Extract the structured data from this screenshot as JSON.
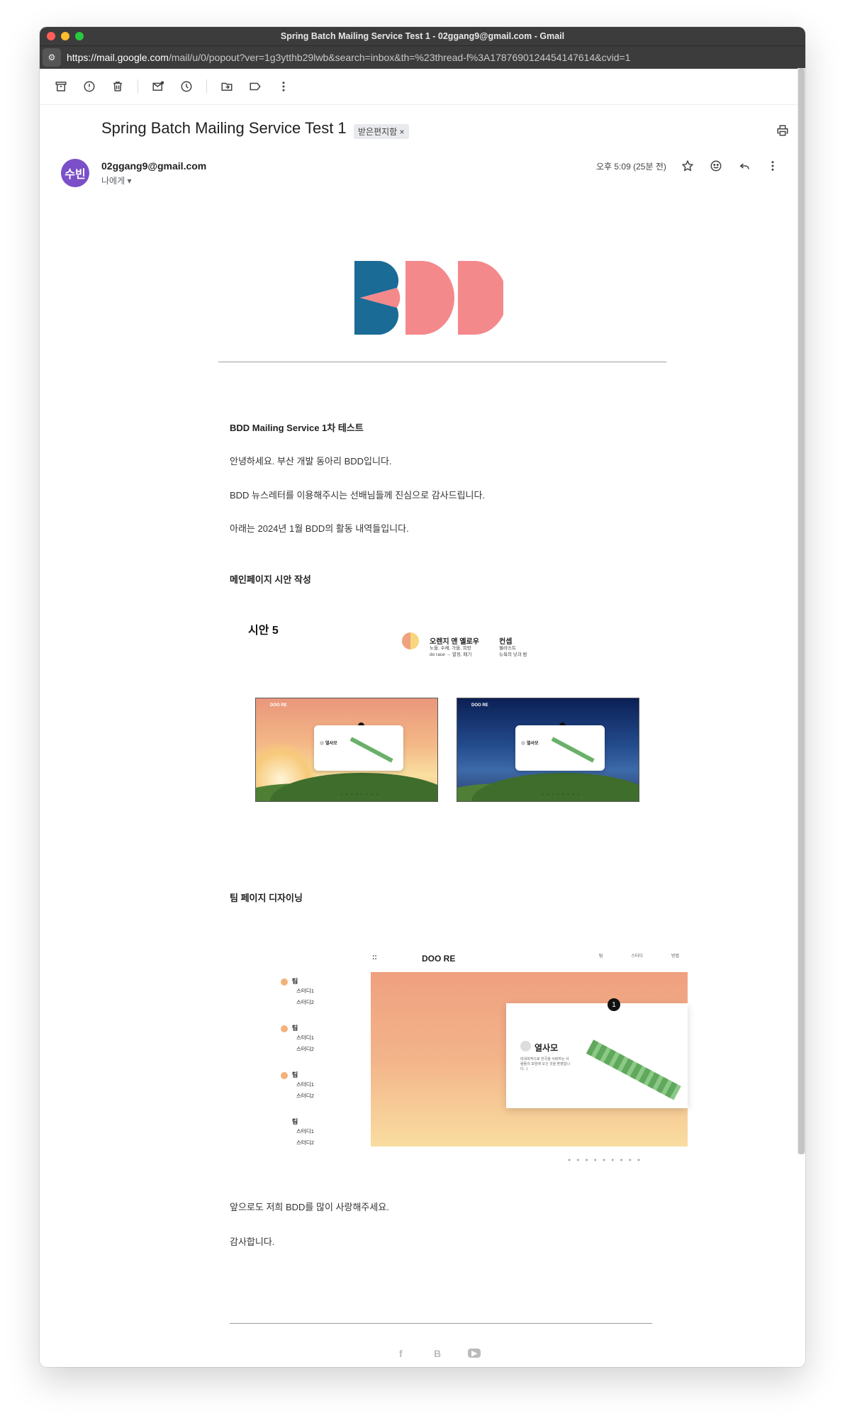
{
  "window": {
    "title": "Spring Batch Mailing Service Test 1 - 02ggang9@gmail.com - Gmail"
  },
  "url": {
    "host": "https://mail.google.com",
    "path": "/mail/u/0/popout?ver=1g3ytthb29lwb&search=inbox&th=%23thread-f%3A1787690124454147614&cvid=1"
  },
  "toolbar": {
    "icons": [
      "archive-icon",
      "report-spam-icon",
      "delete-icon",
      "mark-unread-icon",
      "snooze-icon",
      "move-to-icon",
      "label-icon",
      "more-icon"
    ]
  },
  "email": {
    "subject": "Spring Batch Mailing Service Test 1",
    "label_chip": "받은편지함 ×",
    "avatar_text": "수빈",
    "sender": "02ggang9@gmail.com",
    "to": "나에게 ▾",
    "time": "오후 5:09 (25분 전)"
  },
  "content": {
    "heading": "BDD Mailing Service 1차 테스트",
    "p1": "안녕하세요. 부산 개발 동아리 BDD입니다.",
    "p2": "BDD 뉴스레터를 이용해주시는 선배님들께 진심으로 감사드립니다.",
    "p3": "아래는 2024년 1월 BDD의 활동 내역들입니다.",
    "section1": "메인페이지 시안 작성",
    "sian": "시안 5",
    "legend1_title": "오렌지 앤 옐로우",
    "legend1_sub1": "노을, 수채, 가을, 희망",
    "legend1_sub2": "do race → 열정, 패기",
    "legend2_title": "컨셉",
    "legend2_sub1": "웰라스트",
    "legend2_sub2": "뉴욕의 낮과 밤",
    "shot_brand": "DOO RE",
    "shot_card_title": "열사모",
    "section2": "팀 페이지 디자이닝",
    "team_items": [
      {
        "title": "팀",
        "subs": [
          "스터디1",
          "스터디2"
        ]
      },
      {
        "title": "팀",
        "subs": [
          "스터디1",
          "스터디2"
        ]
      },
      {
        "title": "팀",
        "subs": [
          "스터디1",
          "스터디2"
        ]
      },
      {
        "title": "팀",
        "subs": [
          "스터디1",
          "스터디2"
        ]
      }
    ],
    "team_brand": "DOO RE",
    "team_nav": [
      "팀",
      "스터디",
      "방법"
    ],
    "team_card_title": "열사모",
    "team_card_text": "대내외적으로 한국을 사랑하는 사람들의 모임에 오신 것을 환영합니다. :)",
    "team_badge": "1",
    "closing1": "앞으로도 저희 BDD를 많이 사랑해주세요.",
    "closing2": "감사합니다."
  },
  "logo_colors": {
    "blue": "#1a6b95",
    "pink": "#f4898b"
  },
  "social": {
    "facebook": "f",
    "blog": "B",
    "youtube": "▶"
  }
}
